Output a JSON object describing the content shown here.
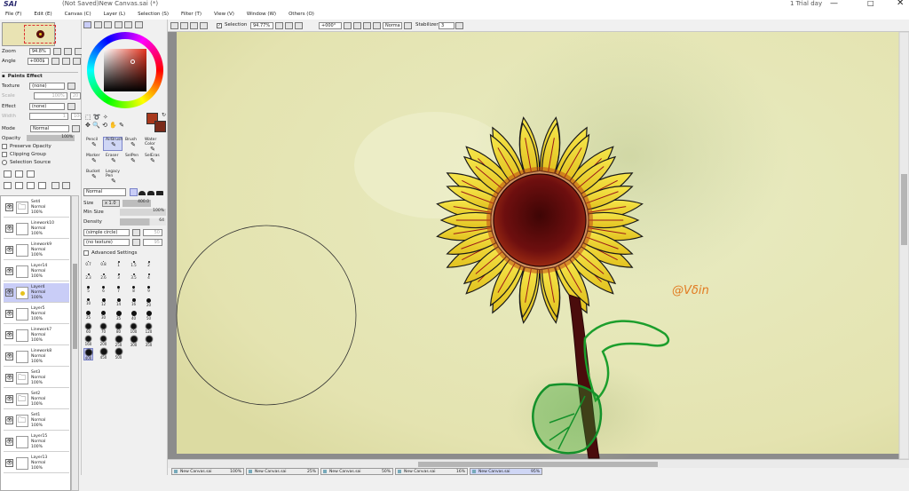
{
  "window": {
    "title": "(Not Saved)New Canvas.sai (*)",
    "app_logo": "SAI",
    "trial": "1 Trial day"
  },
  "menu": [
    "File (F)",
    "Edit (E)",
    "Canvas (C)",
    "Layer (L)",
    "Selection (S)",
    "Filter (T)",
    "View (V)",
    "Window (W)",
    "Others (O)"
  ],
  "navigator": {
    "zoom_label": "Zoom",
    "zoom_value": "94.8%",
    "angle_label": "Angle",
    "angle_value": "+000$"
  },
  "paint_effect": {
    "header": "Paints Effect",
    "texture_label": "Texture",
    "texture_value": "(none)",
    "scale_label": "Scale",
    "scale_value": "100%",
    "scale_num": "20",
    "effect_label": "Effect",
    "effect_value": "(none)",
    "width_label": "Width",
    "width_value": "1",
    "width_num": "100"
  },
  "layer_props": {
    "mode_label": "Mode",
    "mode_value": "Normal",
    "opacity_label": "Opacity",
    "opacity_value": "100%",
    "preserve_opacity": "Preserve Opacity",
    "clipping_group": "Clipping Group",
    "selection_source": "Selection Source"
  },
  "layers": [
    {
      "name": "Set4",
      "mode": "Normal",
      "opacity": "100%",
      "type": "folder"
    },
    {
      "name": "Linework10",
      "mode": "Normal",
      "opacity": "100%",
      "type": "linework"
    },
    {
      "name": "Linework9",
      "mode": "Normal",
      "opacity": "100%",
      "type": "linework"
    },
    {
      "name": "Layer14",
      "mode": "Normal",
      "opacity": "100%",
      "type": "layer"
    },
    {
      "name": "Layer4",
      "mode": "Normal",
      "opacity": "100%",
      "type": "layer",
      "selected": true
    },
    {
      "name": "Layer5",
      "mode": "Normal",
      "opacity": "100%",
      "type": "layer"
    },
    {
      "name": "Linework7",
      "mode": "Normal",
      "opacity": "100%",
      "type": "linework"
    },
    {
      "name": "Linework8",
      "mode": "Normal",
      "opacity": "100%",
      "type": "linework"
    },
    {
      "name": "Set3",
      "mode": "Normal",
      "opacity": "100%",
      "type": "folder"
    },
    {
      "name": "Set2",
      "mode": "Normal",
      "opacity": "100%",
      "type": "folder"
    },
    {
      "name": "Set1",
      "mode": "Normal",
      "opacity": "100%",
      "type": "folder"
    },
    {
      "name": "Layer15",
      "mode": "Normal",
      "opacity": "100%",
      "type": "layer"
    },
    {
      "name": "Layer13",
      "mode": "Normal",
      "opacity": "100%",
      "type": "layer"
    }
  ],
  "tools": [
    {
      "name": "Pencil"
    },
    {
      "name": "AirBrush",
      "active": true
    },
    {
      "name": "Brush"
    },
    {
      "name": "Water Color"
    },
    {
      "name": "Marker"
    },
    {
      "name": "Eraser"
    },
    {
      "name": "SelPen"
    },
    {
      "name": "SelEras"
    },
    {
      "name": "Bucket"
    },
    {
      "name": "Legacy Pen"
    }
  ],
  "brush": {
    "blend": "Normal",
    "size_label": "Size",
    "size_mult": "x 1.0",
    "size_value": "400.0",
    "min_size_label": "Min Size",
    "min_size_value": "100%",
    "density_label": "Density",
    "density_value": "64",
    "shape": "(simple circle)",
    "shape_num": "50",
    "texture": "(no texture)",
    "texture_num": "95",
    "advanced": "Advanced Settings"
  },
  "brush_sizes": [
    "0.7",
    "0.8",
    "1",
    "1.5",
    "2",
    "2.3",
    "2.6",
    "3",
    "3.5",
    "4",
    "5",
    "6",
    "7",
    "8",
    "9",
    "10",
    "12",
    "14",
    "16",
    "20",
    "25",
    "30",
    "35",
    "40",
    "50",
    "60",
    "70",
    "80",
    "100",
    "120",
    "160",
    "200",
    "250",
    "300",
    "350",
    "400",
    "450",
    "500"
  ],
  "canvas_toolbar": {
    "selection_label": "Selection",
    "zoom": "94.77%",
    "angle": "+000°",
    "mode": "Norma",
    "stabilizer_label": "Stabilizer",
    "stabilizer_value": "3"
  },
  "signature": "@Vδin",
  "tabs": [
    {
      "name": "New Canvas.sai",
      "zoom": "100%"
    },
    {
      "name": "New Canvas.sai",
      "zoom": "25%"
    },
    {
      "name": "New Canvas.sai",
      "zoom": "50%"
    },
    {
      "name": "New Canvas.sai",
      "zoom": "16%"
    },
    {
      "name": "New Canvas.sai",
      "zoom": "95%",
      "active": true
    }
  ],
  "colors": {
    "primary": "#a8381c",
    "secondary": "#7a2a1a",
    "accent": "#7d86c9"
  }
}
